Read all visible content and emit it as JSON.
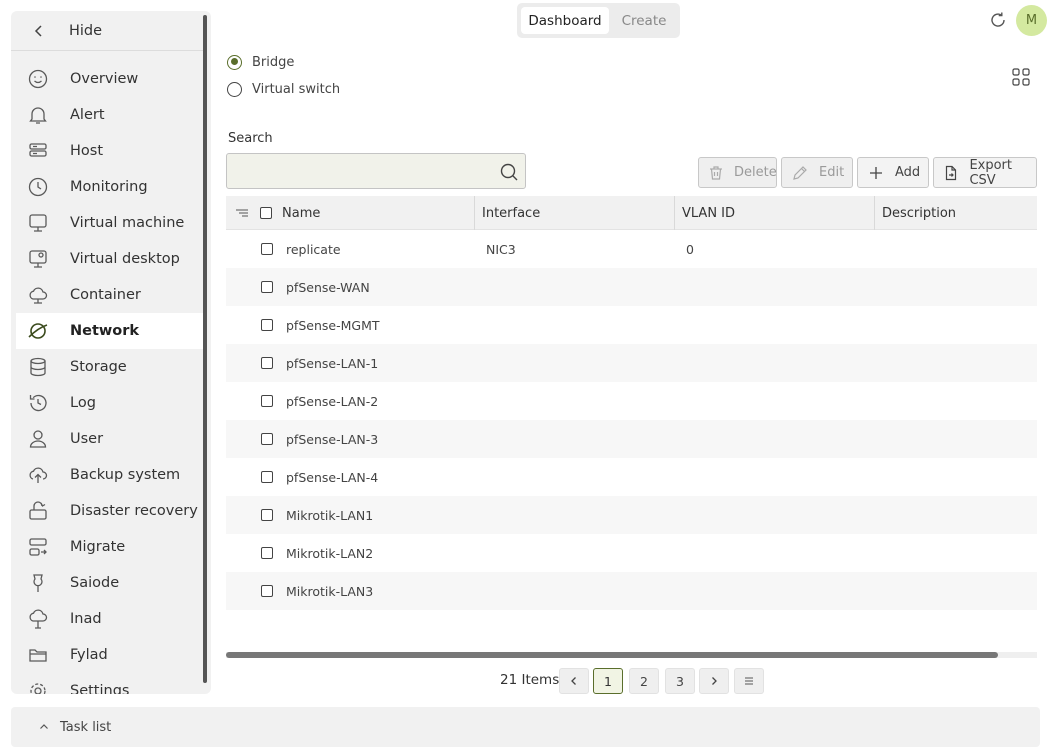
{
  "sidebar": {
    "hide_label": "Hide",
    "items": [
      {
        "label": "Overview",
        "icon": "smiley-icon"
      },
      {
        "label": "Alert",
        "icon": "bell-icon"
      },
      {
        "label": "Host",
        "icon": "server-icon"
      },
      {
        "label": "Monitoring",
        "icon": "clock-icon"
      },
      {
        "label": "Virtual machine",
        "icon": "monitor-icon"
      },
      {
        "label": "Virtual desktop",
        "icon": "desktop-icon"
      },
      {
        "label": "Container",
        "icon": "cloud-icon"
      },
      {
        "label": "Network",
        "icon": "planet-icon",
        "active": true
      },
      {
        "label": "Storage",
        "icon": "database-icon"
      },
      {
        "label": "Log",
        "icon": "history-icon"
      },
      {
        "label": "User",
        "icon": "user-icon"
      },
      {
        "label": "Backup system",
        "icon": "cloud-upload-icon"
      },
      {
        "label": "Disaster recovery",
        "icon": "recovery-icon"
      },
      {
        "label": "Migrate",
        "icon": "migrate-icon"
      },
      {
        "label": "Saiode",
        "icon": "pin-icon"
      },
      {
        "label": "Inad",
        "icon": "tree-icon"
      },
      {
        "label": "Fylad",
        "icon": "folder-icon"
      },
      {
        "label": "Settings",
        "icon": "gear-icon"
      }
    ]
  },
  "top_tabs": {
    "dashboard": "Dashboard",
    "create": "Create"
  },
  "avatar_initial": "M",
  "radio": {
    "bridge": "Bridge",
    "virtual_switch": "Virtual switch",
    "selected": "Bridge"
  },
  "search": {
    "label": "Search",
    "value": "",
    "placeholder": ""
  },
  "actions": {
    "delete": "Delete",
    "edit": "Edit",
    "add": "Add",
    "export": "Export CSV"
  },
  "table": {
    "columns": [
      "Name",
      "Interface",
      "VLAN ID",
      "Description"
    ],
    "rows": [
      {
        "name": "replicate",
        "interface": "NIC3",
        "vlan": "0",
        "description": ""
      },
      {
        "name": "pfSense-WAN",
        "interface": "",
        "vlan": "",
        "description": ""
      },
      {
        "name": "pfSense-MGMT",
        "interface": "",
        "vlan": "",
        "description": ""
      },
      {
        "name": "pfSense-LAN-1",
        "interface": "",
        "vlan": "",
        "description": ""
      },
      {
        "name": "pfSense-LAN-2",
        "interface": "",
        "vlan": "",
        "description": ""
      },
      {
        "name": "pfSense-LAN-3",
        "interface": "",
        "vlan": "",
        "description": ""
      },
      {
        "name": "pfSense-LAN-4",
        "interface": "",
        "vlan": "",
        "description": ""
      },
      {
        "name": "Mikrotik-LAN1",
        "interface": "",
        "vlan": "",
        "description": ""
      },
      {
        "name": "Mikrotik-LAN2",
        "interface": "",
        "vlan": "",
        "description": ""
      },
      {
        "name": "Mikrotik-LAN3",
        "interface": "",
        "vlan": "",
        "description": ""
      }
    ]
  },
  "pagination": {
    "total": "21 Items",
    "pages": [
      "1",
      "2",
      "3"
    ],
    "current": "1"
  },
  "task_list": "Task list",
  "colors": {
    "accent": "#5a6e2b",
    "avatar_bg": "#d4e9a0"
  }
}
